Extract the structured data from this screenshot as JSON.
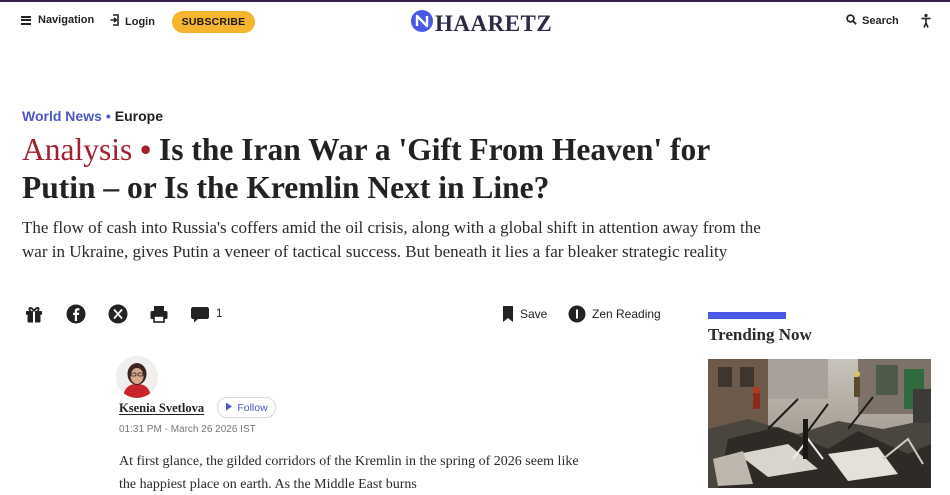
{
  "header": {
    "nav_label": "Navigation",
    "login_label": "Login",
    "subscribe_label": "SUBSCRIBE",
    "logo_text": "HAARETZ",
    "search_label": "Search",
    "icons": [
      "hamburger-menu-icon",
      "login-icon",
      "haaretz-logo-icon",
      "search-icon",
      "accessibility-icon"
    ],
    "colors": {
      "subscribe_bg": "#f5b52e",
      "logo_blue": "#4a58e6",
      "top_line": "#3b1f4f"
    }
  },
  "breadcrumb": {
    "section": "World News",
    "separator": "•",
    "subsection": "Europe"
  },
  "article": {
    "kicker": "Analysis",
    "kicker_separator": "•",
    "title": "Is the Iran War a 'Gift From Heaven' for Putin – or Is the Kremlin Next in Line?",
    "subtitle": "The flow of cash into Russia's coffers amid the oil crisis, along with a global shift in attention away from the war in Ukraine, gives Putin a veneer of tactical success. But beneath it lies a far bleaker strategic reality",
    "colors": {
      "kicker": "#a2202e",
      "link_blue": "#4a58c6"
    }
  },
  "toolbar": {
    "comment_count": "1",
    "save_label": "Save",
    "zen_label": "Zen Reading",
    "icons": [
      "gift-icon",
      "facebook-icon",
      "x-twitter-icon",
      "print-icon",
      "comment-icon",
      "bookmark-icon",
      "zen-reading-icon"
    ]
  },
  "author": {
    "name": "Ksenia Svetlova",
    "follow_label": "Follow",
    "timestamp": "01:31 PM - March 26 2026 IST"
  },
  "body": {
    "first_paragraph": "At first glance, the gilded corridors of the Kremlin in the spring of 2026 seem like the happiest place on earth. As the Middle East burns"
  },
  "trending": {
    "title": "Trending Now"
  }
}
